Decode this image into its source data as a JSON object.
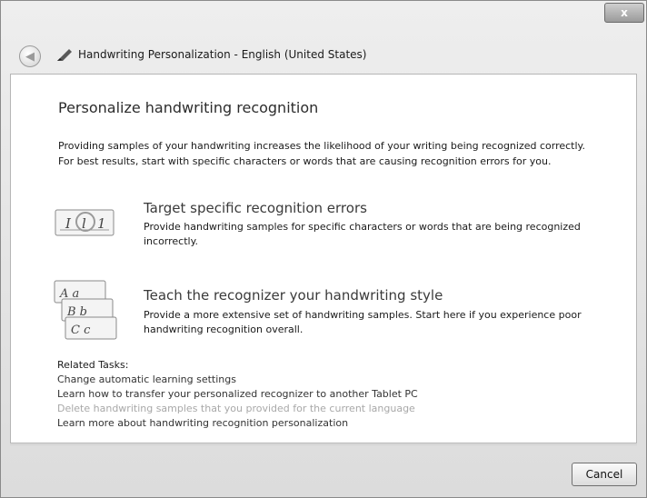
{
  "window": {
    "title": "Handwriting Personalization - English (United States)",
    "close_label": "x"
  },
  "content": {
    "heading": "Personalize handwriting recognition",
    "intro_line1": "Providing samples of your handwriting increases the likelihood of your writing being recognized correctly.",
    "intro_line2": "For best results, start with specific characters or words that are causing recognition errors for you."
  },
  "options": [
    {
      "title": "Target specific recognition errors",
      "desc_line1": "Provide handwriting samples for specific characters or words that are being recognized",
      "desc_line2": "incorrectly.",
      "icon": "handwriting-error-icon"
    },
    {
      "title": "Teach the recognizer your handwriting style",
      "desc_line1": "Provide a more extensive set of handwriting samples. Start here if you experience poor",
      "desc_line2": "handwriting recognition overall.",
      "icon": "handwriting-style-icon"
    }
  ],
  "related": {
    "label": "Related Tasks:",
    "links": [
      "Change automatic learning settings",
      "Learn how to transfer your personalized recognizer to another Tablet PC",
      "Delete handwriting samples that you provided for the current language",
      "Learn more about handwriting recognition personalization"
    ]
  },
  "footer": {
    "cancel_label": "Cancel"
  }
}
